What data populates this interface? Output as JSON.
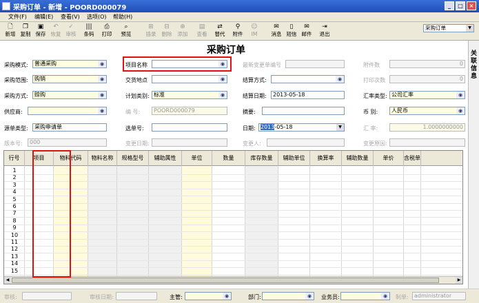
{
  "window": {
    "title": "采购订单 - 新增 - POORD000079"
  },
  "menu": [
    "文件(F)",
    "编辑(E)",
    "查看(V)",
    "选项(O)",
    "帮助(H)"
  ],
  "toolbar": {
    "new": "新增",
    "copy": "复制",
    "save": "保存",
    "restore": "恢复",
    "audit": "审核",
    "barcode": "条码",
    "print": "打印",
    "preview": "预览",
    "insert": "插录",
    "delete": "删除",
    "add": "添加",
    "view": "查看",
    "replace": "替代",
    "attach": "附件",
    "im": "IM",
    "message": "消息",
    "sms": "短信",
    "mail": "邮件",
    "exit": "退出",
    "select_value": "采购订单"
  },
  "right_panel": [
    "关",
    "联",
    "信",
    "息"
  ],
  "form": {
    "title": "采购订单",
    "purchase_mode": {
      "label": "采购模式:",
      "value": "普通采购"
    },
    "project_name": {
      "label": "项目名称",
      "value": ""
    },
    "latest_change_no": {
      "label": "最新变更单编号",
      "value": ""
    },
    "attach_count": {
      "label": "附件数",
      "value": "0"
    },
    "purchase_scope": {
      "label": "采购范围:",
      "value": "购销"
    },
    "delivery_place": {
      "label": "交货地点",
      "value": ""
    },
    "settle_method": {
      "label": "结算方式:",
      "value": ""
    },
    "print_count": {
      "label": "打印次数",
      "value": "0"
    },
    "purchase_method": {
      "label": "采购方式:",
      "value": "赊购"
    },
    "plan_type": {
      "label": "计划类别:",
      "value": "标准"
    },
    "settle_date": {
      "label": "结算日期:",
      "value": "2013-05-18"
    },
    "rate_type": {
      "label": "汇率类型:",
      "value": "公司汇率"
    },
    "supplier": {
      "label": "供应商:",
      "value": ""
    },
    "number": {
      "label": "编    号:",
      "value": "POORD000079"
    },
    "summary": {
      "label": "摘要:",
      "value": ""
    },
    "currency": {
      "label": "币    别:",
      "value": "人民币"
    },
    "source_type": {
      "label": "源单类型:",
      "value": "采购申请单"
    },
    "source_no": {
      "label": "选单号:",
      "value": ""
    },
    "date": {
      "label": "日期:",
      "value_sel": "2013",
      "value_rest": "-05-18"
    },
    "exchange_rate": {
      "label": "汇    率:",
      "value": "1.0000000000"
    },
    "version": {
      "label": "版本号:",
      "value": "000"
    },
    "change_date": {
      "label": "变更日期:",
      "value": ""
    },
    "changer": {
      "label": "变更人:",
      "value": ""
    },
    "change_reason": {
      "label": "变更原因:",
      "value": ""
    }
  },
  "grid": {
    "headers": [
      "行号",
      "项目",
      "物料代码",
      "物料名称",
      "规格型号",
      "辅助属性",
      "单位",
      "数量",
      "库存数量",
      "辅助单位",
      "换算率",
      "辅助数量",
      "单价",
      "含税单"
    ],
    "rows": [
      "1",
      "2",
      "3",
      "4",
      "5",
      "6",
      "7",
      "8",
      "9",
      "10",
      "11",
      "12",
      "13",
      "14",
      "15"
    ]
  },
  "footer": {
    "audit": "审核:",
    "audit_date": "审核日期:",
    "supervisor": "主管:",
    "department": "部门:",
    "salesman": "业务员:",
    "maker": "制单:",
    "maker_value": "administrator"
  }
}
